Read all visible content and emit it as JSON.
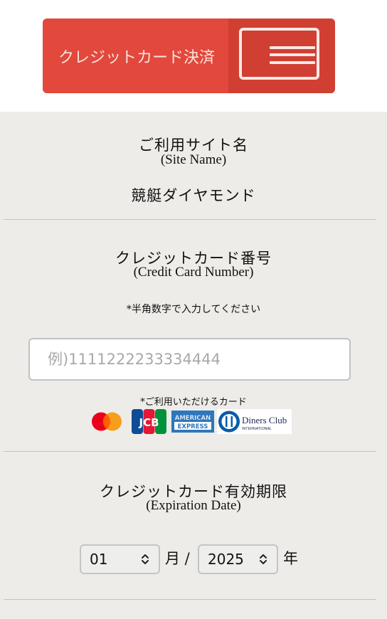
{
  "header": {
    "title": "クレジットカード決済",
    "menu_icon": "hamburger-menu-icon",
    "colors": {
      "background": "#e2483c",
      "accent_dark": "#d13f33",
      "text": "#fbe3df"
    }
  },
  "site": {
    "label_jp": "ご利用サイト名",
    "label_en": "(Site Name)",
    "value": "競艇ダイヤモンド"
  },
  "card_number": {
    "label_jp": "クレジットカード番号",
    "label_en": "(Credit Card Number)",
    "note": "*半角数字で入力してください",
    "placeholder": "例)1111222233334444",
    "value": ""
  },
  "accepted_cards": {
    "label": "*ご利用いただけるカード",
    "brands": [
      "Mastercard",
      "JCB",
      "American Express",
      "Diners Club International"
    ]
  },
  "expiration": {
    "label_jp": "クレジットカード有効期限",
    "label_en": "(Expiration Date)",
    "month": "01",
    "month_unit": "月 /",
    "year": "2025",
    "year_unit": "年"
  },
  "colors": {
    "content_background": "#edece8",
    "divider": "#c4c3bf"
  }
}
